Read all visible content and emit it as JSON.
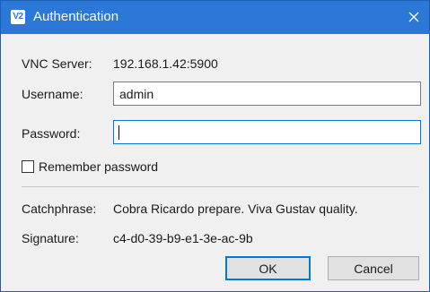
{
  "window": {
    "title": "Authentication",
    "icon": "vnc-viewer-icon",
    "icon_text": "V2"
  },
  "colors": {
    "titlebar": "#2b78d8",
    "focus_border": "#0078d7",
    "dialog_background": "#f0f0f0"
  },
  "form": {
    "server_label": "VNC Server:",
    "server_value": "192.168.1.42:5900",
    "username_label": "Username:",
    "username_value": "admin",
    "password_label": "Password:",
    "password_value": "",
    "remember_label": "Remember password",
    "remember_checked": false
  },
  "info": {
    "catchphrase_label": "Catchphrase:",
    "catchphrase_value": "Cobra Ricardo prepare. Viva Gustav quality.",
    "signature_label": "Signature:",
    "signature_value": "c4-d0-39-b9-e1-3e-ac-9b"
  },
  "buttons": {
    "ok_label": "OK",
    "cancel_label": "Cancel"
  }
}
